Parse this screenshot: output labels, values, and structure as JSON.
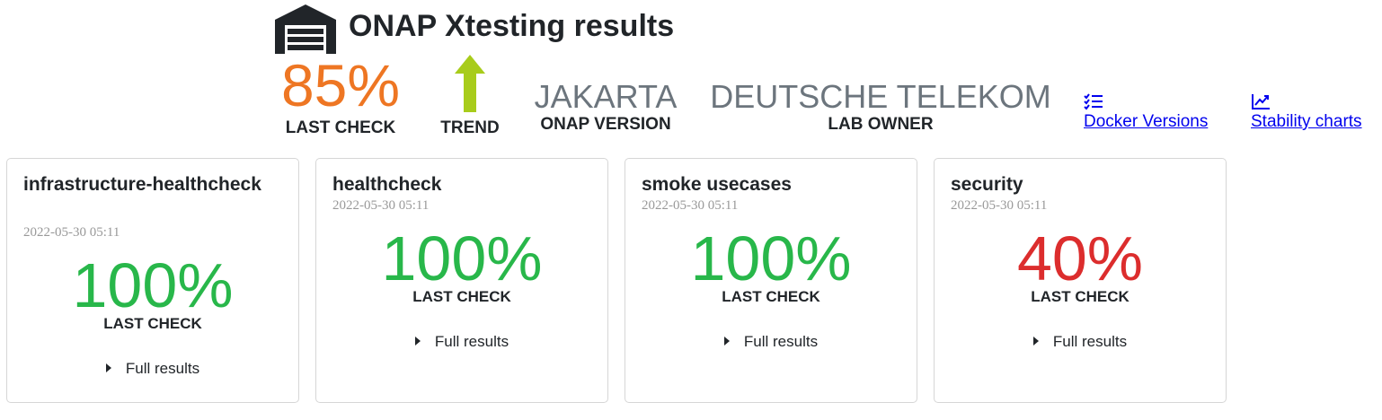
{
  "header": {
    "title": "ONAP Xtesting results",
    "logo_icon": "warehouse-icon",
    "last_check": {
      "value": "85%",
      "label": "LAST CHECK",
      "color": "#ee7623"
    },
    "trend": {
      "label": "TREND",
      "direction": "up",
      "icon": "arrow-up-icon",
      "color": "#a8cc1b"
    },
    "onap_version": {
      "value": "JAKARTA",
      "label": "ONAP VERSION"
    },
    "lab_owner": {
      "value": "DEUTSCHE TELEKOM",
      "label": "LAB OWNER"
    },
    "links": [
      {
        "label": "Docker Versions",
        "icon": "checklist-icon"
      },
      {
        "label": "Stability charts",
        "icon": "line-chart-icon"
      }
    ]
  },
  "cards": [
    {
      "title": "infrastructure-healthcheck",
      "date": "2022-05-30 05:11",
      "value": "100%",
      "status": "pass",
      "label": "LAST CHECK",
      "full_results": "Full results"
    },
    {
      "title": "healthcheck",
      "date": "2022-05-30 05:11",
      "value": "100%",
      "status": "pass",
      "label": "LAST CHECK",
      "full_results": "Full results"
    },
    {
      "title": "smoke usecases",
      "date": "2022-05-30 05:11",
      "value": "100%",
      "status": "pass",
      "label": "LAST CHECK",
      "full_results": "Full results"
    },
    {
      "title": "security",
      "date": "2022-05-30 05:11",
      "value": "40%",
      "status": "fail",
      "label": "LAST CHECK",
      "full_results": "Full results"
    }
  ],
  "colors": {
    "pass": "#28b74a",
    "fail": "#dc2d2d",
    "muted": "#6c757d",
    "link": "#0000ee"
  }
}
